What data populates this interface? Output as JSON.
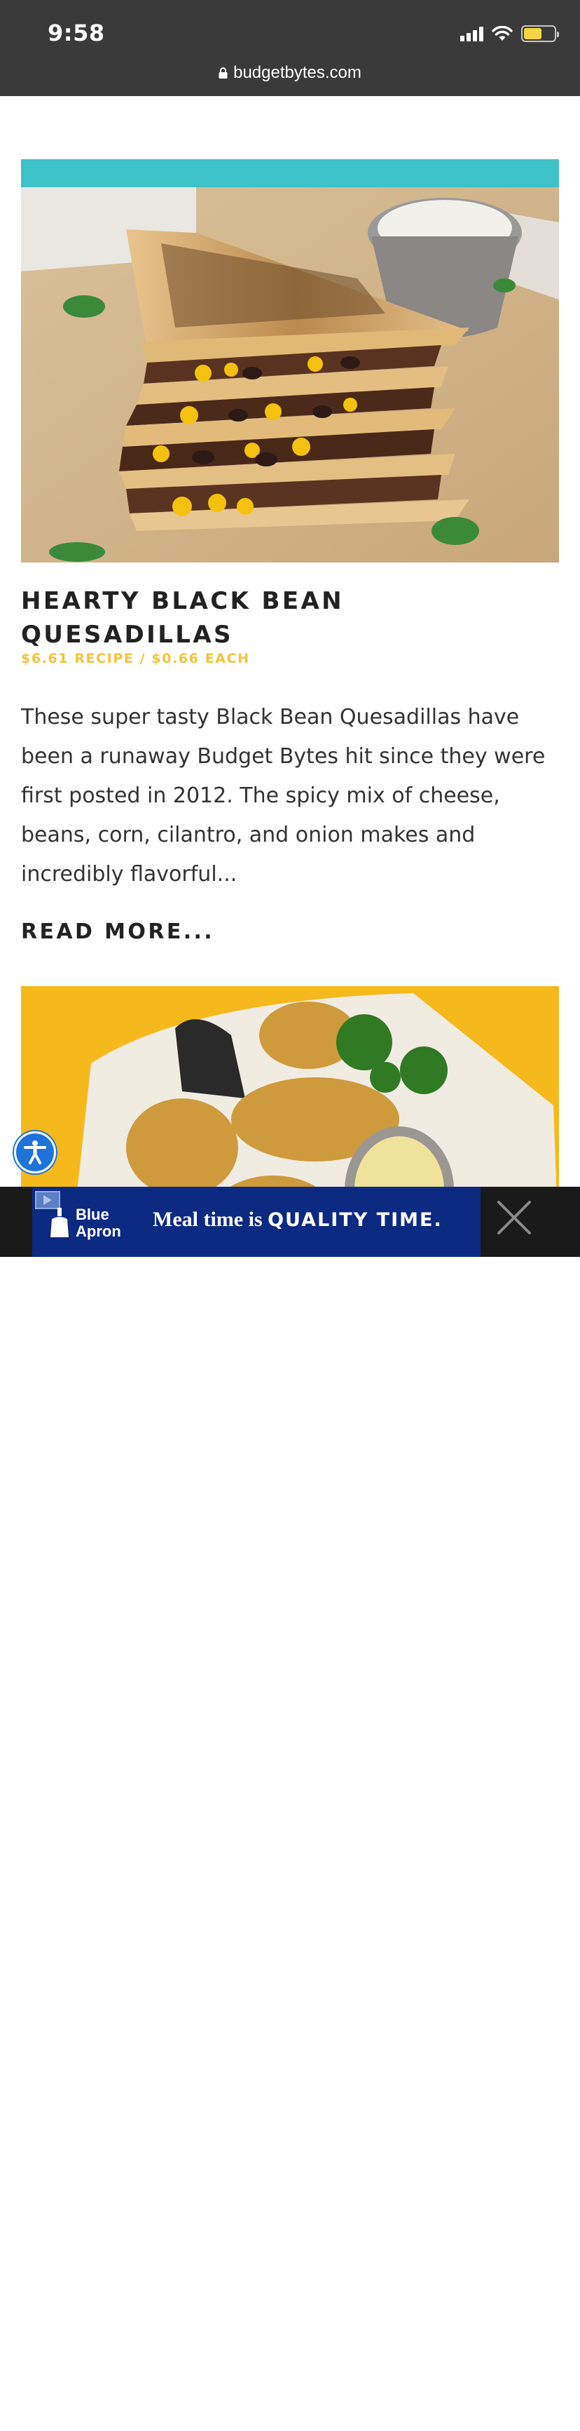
{
  "status_bar": {
    "time": "9:58",
    "battery_level": 0.6,
    "battery_color": "#f7d542"
  },
  "browser": {
    "url": "budgetbytes.com",
    "icon": "lock-icon"
  },
  "post": {
    "title": "HEARTY BLACK BEAN QUESADILLAS",
    "price": "$6.61 RECIPE / $0.66 EACH",
    "excerpt": "These super tasty Black Bean Quesadillas have been a runaway Budget Bytes hit since they were first posted in 2012. The spicy mix of cheese, beans, corn, cilantro, and onion makes and incredibly flavorful...",
    "read_more": "READ MORE...",
    "image": "stacked-quesadillas-photo",
    "accent_color": "#f2c53d"
  },
  "next_post": {
    "image": "chicken-wings-basket-photo"
  },
  "accessibility": {
    "icon": "accessibility-icon",
    "color": "#1e73d9"
  },
  "ad": {
    "brand_line1": "Blue",
    "brand_line2": "Apron",
    "headline_serif": "Meal time is ",
    "headline_caps": "QUALITY TIME.",
    "background": "#0d2a82",
    "close_icon": "close-icon",
    "adchoices_icon": "adchoices-icon"
  }
}
